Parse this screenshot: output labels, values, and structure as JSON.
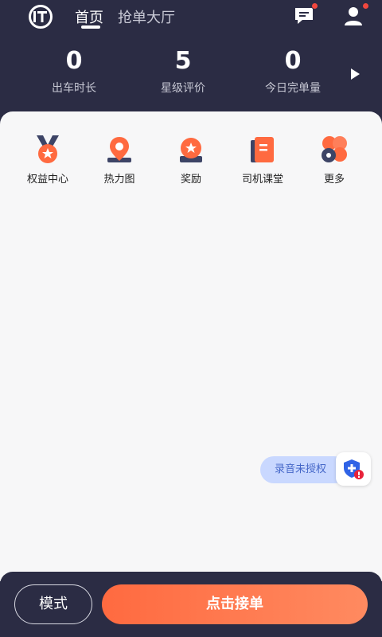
{
  "header": {
    "tabs": [
      "首页",
      "抢单大厅"
    ],
    "active_tab": "首页",
    "icons": [
      "logo-icon",
      "message-icon",
      "user-icon"
    ]
  },
  "stats": [
    {
      "value": "0",
      "label": "出车时长"
    },
    {
      "value": "5",
      "label": "星级评价"
    },
    {
      "value": "0",
      "label": "今日完单量"
    }
  ],
  "menu": [
    {
      "label": "权益中心",
      "icon": "medal-icon"
    },
    {
      "label": "热力图",
      "icon": "location-pin-icon"
    },
    {
      "label": "奖励",
      "icon": "reward-icon"
    },
    {
      "label": "司机课堂",
      "icon": "book-icon"
    },
    {
      "label": "更多",
      "icon": "more-icon"
    }
  ],
  "recording": {
    "label": "录音未授权"
  },
  "bottom": {
    "mode_label": "模式",
    "accept_label": "点击接单"
  },
  "colors": {
    "header_bg": "#2b2c44",
    "accent": "#ff6a40",
    "content_bg": "#f7f7f8"
  }
}
